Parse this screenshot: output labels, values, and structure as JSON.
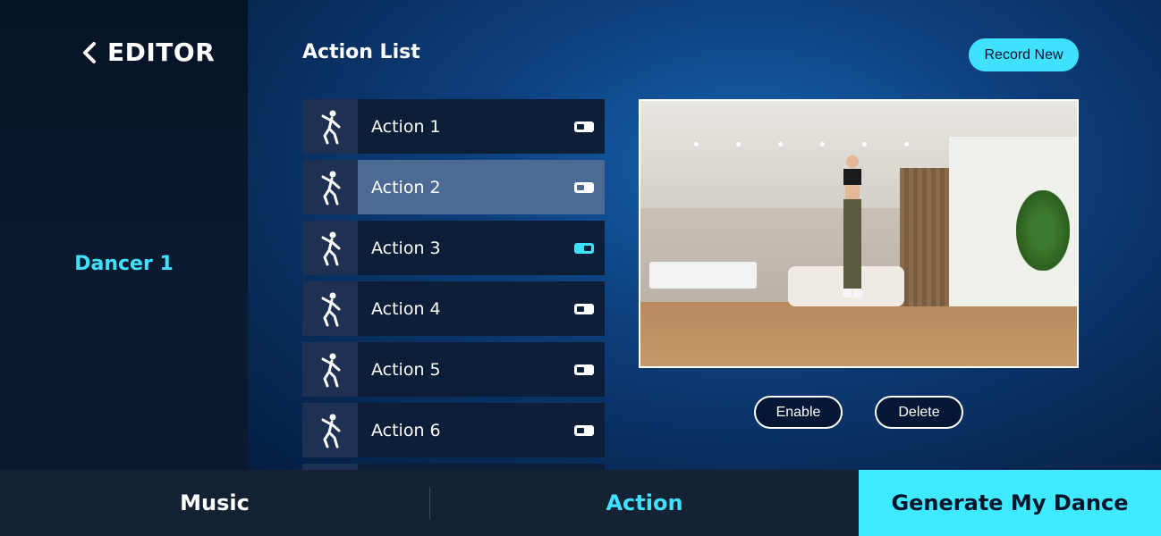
{
  "header": {
    "back_label": "EDITOR"
  },
  "sidebar": {
    "dancer_label": "Dancer 1"
  },
  "main": {
    "title": "Action List",
    "record_button": "Record New",
    "actions": [
      {
        "label": "Action 1",
        "enabled": false
      },
      {
        "label": "Action 2",
        "enabled": false,
        "selected": true
      },
      {
        "label": "Action 3",
        "enabled": true
      },
      {
        "label": "Action 4",
        "enabled": false
      },
      {
        "label": "Action 5",
        "enabled": false
      },
      {
        "label": "Action 6",
        "enabled": false
      }
    ],
    "enable_button": "Enable",
    "delete_button": "Delete"
  },
  "bottom_nav": {
    "music": "Music",
    "action": "Action",
    "generate": "Generate My Dance"
  },
  "colors": {
    "accent": "#3fe1ff",
    "selected_row": "#4b6a94"
  },
  "icons": {
    "back": "chevron-left-icon",
    "action_thumb": "dancer-icon"
  }
}
